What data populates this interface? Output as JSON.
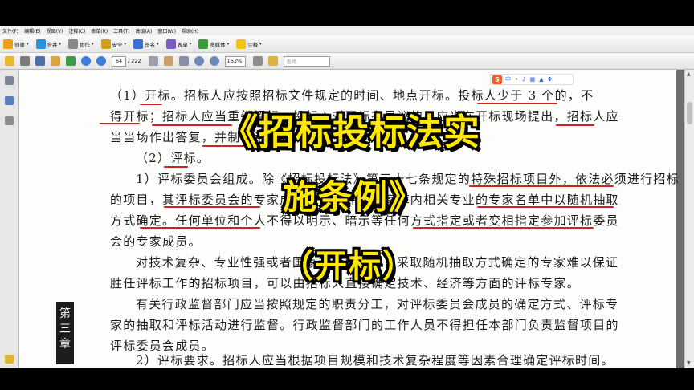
{
  "menu": [
    "文件(F)",
    "编辑(E)",
    "视图(V)",
    "注释(C)",
    "表单(R)",
    "工具(T)",
    "高级(A)",
    "窗口(W)",
    "帮助(H)"
  ],
  "toolbar1": [
    {
      "label": "创建",
      "icon": "create-icon",
      "color": "#e8a21a"
    },
    {
      "label": "合并",
      "icon": "combine-icon",
      "color": "#2e8fd6"
    },
    {
      "label": "协作",
      "icon": "collaborate-icon",
      "color": "#888888"
    },
    {
      "label": "安全",
      "icon": "lock-icon",
      "color": "#d4a017"
    },
    {
      "label": "签名",
      "icon": "pen-icon",
      "color": "#3a6fcf"
    },
    {
      "label": "表单",
      "icon": "form-icon",
      "color": "#7a5bc9"
    },
    {
      "label": "多媒体",
      "icon": "multimedia-icon",
      "color": "#3a9b3a"
    },
    {
      "label": "注释",
      "icon": "comment-icon",
      "color": "#f0c21a"
    }
  ],
  "toolbar2": {
    "page_current": "64",
    "page_total": "/ 222",
    "zoom": "162%",
    "find_placeholder": "查找"
  },
  "document": {
    "lines": [
      "（1）开标。招标人应按照招标文件规定的时间、地点开标。投标人少于 3 个的，不",
      "得开标；招标人应当重新招标。投标人对开标有异议的，应当在开标现场提出，招标人应",
      "当当场作出答复，并制作记录。",
      "（2）评标。",
      "1）评标委员会组成。除《招标投标法》第三十七条规定的特殊招标项目外，依法必须进行招标",
      "的项目，其评标委员会的专家成员应当从评标专家库内相关专业的专家名单中以随机抽取",
      "方式确定。任何单位和个人不得以明示、暗示等任何方式指定或者变相指定参加评标委员",
      "会的专家成员。",
      "对技术复杂、专业性强或者国家有特殊要求，采取随机抽取方式确定的专家难以保证",
      "胜任评标工作的招标项目，可以由招标人直接确定技术、经济等方面的评标专家。",
      "有关行政监督部门应当按照规定的职责分工，对评标委员会成员的确定方式、评标专",
      "家的抽取和评标活动进行监督。行政监督部门的工作人员不得担任本部门负责监督项目的",
      "评标委员会成员。",
      "2）评标要求。招标人应当根据项目规模和技术复杂程度等因素合理确定评标时间。"
    ],
    "chapter_tab": [
      "第",
      "三",
      "章"
    ]
  },
  "ime": {
    "logo": "S",
    "mode": "中"
  },
  "overlay": {
    "line1": "《招标投标法实",
    "line2": "施条例》",
    "line3": "（开标）"
  },
  "colors": {
    "overlay_text": "#ffe800",
    "annotation": "#d52020"
  }
}
